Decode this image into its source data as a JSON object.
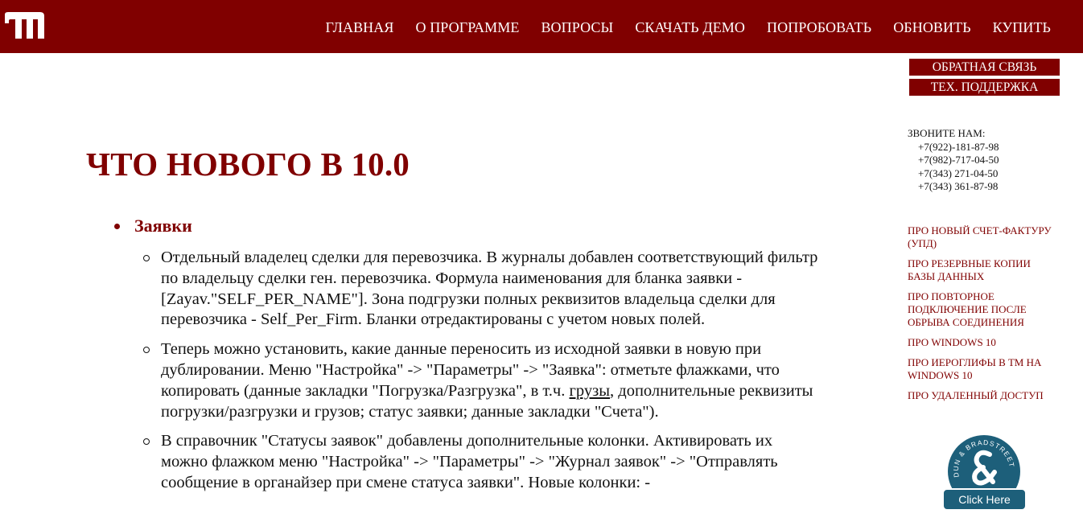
{
  "header": {
    "logo_icon": "tm-logo-icon",
    "nav": [
      "ГЛАВНАЯ",
      "О ПРОГРАММЕ",
      "ВОПРОСЫ",
      "СКАЧАТЬ ДЕМО",
      "ПОПРОБОВАТЬ",
      "ОБНОВИТЬ",
      "КУПИТЬ"
    ]
  },
  "sidebar": {
    "feedback_label": "ОБРАТНАЯ СВЯЗЬ",
    "support_label": "ТЕХ. ПОДДЕРЖКА",
    "call_label": "ЗВОНИТЕ НАМ:",
    "phones": [
      "+7(922)-181-87-98",
      "+7(982)-717-04-50",
      "+7(343) 271-04-50",
      "+7(343) 361-87-98"
    ],
    "links": [
      "ПРО НОВЫЙ СЧЕТ-ФАКТУРУ (УПД)",
      "ПРО РЕЗЕРВНЫЕ КОПИИ БАЗЫ ДАННЫХ",
      "ПРО ПОВТОРНОЕ ПОДКЛЮЧЕНИЕ ПОСЛЕ ОБРЫВА СОЕДИНЕНИЯ",
      "ПРО WINDOWS 10",
      "ПРО ИЕРОГЛИФЫ В ТМ НА WINDOWS 10",
      "ПРО УДАЛЕННЫЙ ДОСТУП"
    ],
    "badge": {
      "ring_text": "DUN & BRADSTREET",
      "button_label": "Click Here"
    }
  },
  "main": {
    "title": "ЧТО НОВОГО В 10.0",
    "section_title": "Заявки",
    "items": [
      {
        "text": "Отдельный владелец сделки для перевозчика. В журналы добавлен соответствующий фильтр по владельцу сделки ген. перевозчика. Формула наименования для бланка заявки - [Zayav.\"SELF_PER_NAME\"]. Зона подгрузки полных реквизитов владельца сделки для перевозчика - Self_Per_Firm. Бланки отредактированы с учетом новых полей."
      },
      {
        "text_before": "Теперь можно установить, какие данные переносить из исходной заявки в новую при дублировании. Меню \"Настройка\" -> \"Параметры\" -> \"Заявка\": отметьте флажками, что копировать (данные закладки \"Погрузка/Разгрузка\", в т.ч. ",
        "text_underlined": "грузы",
        "text_after": ", дополнительные реквизиты погрузки/разгрузки и грузов; статус заявки; данные закладки \"Счета\")."
      },
      {
        "text": "В справочник \"Статусы заявок\" добавлены дополнительные колонки. Активировать их можно флажком меню \"Настройка\" -> \"Параметры\" -> \"Журнал заявок\" -> \"Отправлять сообщение в органайзер при смене статуса заявки\". Новые колонки: -"
      }
    ]
  },
  "colors": {
    "brand": "#800000",
    "badge": "#1d5f7a"
  }
}
